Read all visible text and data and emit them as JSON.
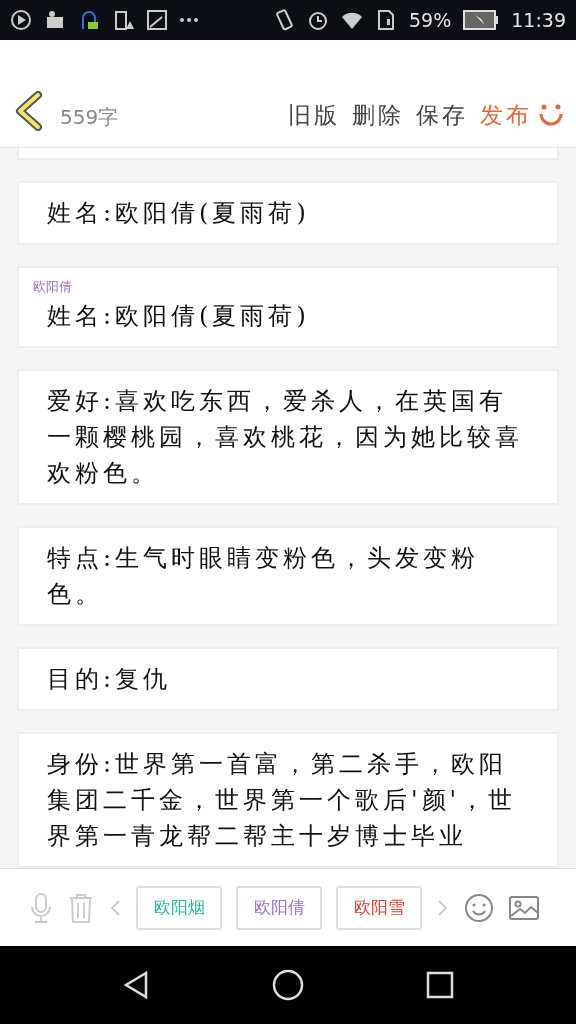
{
  "status_bar": {
    "battery": "59%",
    "time": "11:39"
  },
  "header": {
    "word_count": "559字",
    "actions": [
      {
        "label": "旧版",
        "kind": "plain"
      },
      {
        "label": "删除",
        "kind": "plain"
      },
      {
        "label": "保存",
        "kind": "plain"
      },
      {
        "label": "发布",
        "kind": "primary"
      }
    ]
  },
  "paragraphs": [
    {
      "text": "姓名:欧阳倩(夏雨荷)"
    },
    {
      "speaker": "欧阳倩",
      "color": "#a070c8",
      "text": "姓名:欧阳倩(夏雨荷)"
    },
    {
      "text": "爱好:喜欢吃东西，爱杀人，在英国有一颗樱桃园，喜欢桃花，因为她比较喜欢粉色。"
    },
    {
      "text": "特点:生气时眼睛变粉色，头发变粉色。"
    },
    {
      "text": "目的:复仇"
    },
    {
      "text": "身份:世界第一首富，第二杀手，欧阳集团二千金，世界第一个歌后'颜'，世界第一青龙帮二帮主十岁博士毕业"
    }
  ],
  "characters": [
    {
      "name": "欧阳烟",
      "color": "#2ab5a0"
    },
    {
      "name": "欧阳倩",
      "color": "#a070c8"
    },
    {
      "name": "欧阳雪",
      "color": "#d9412f"
    }
  ]
}
